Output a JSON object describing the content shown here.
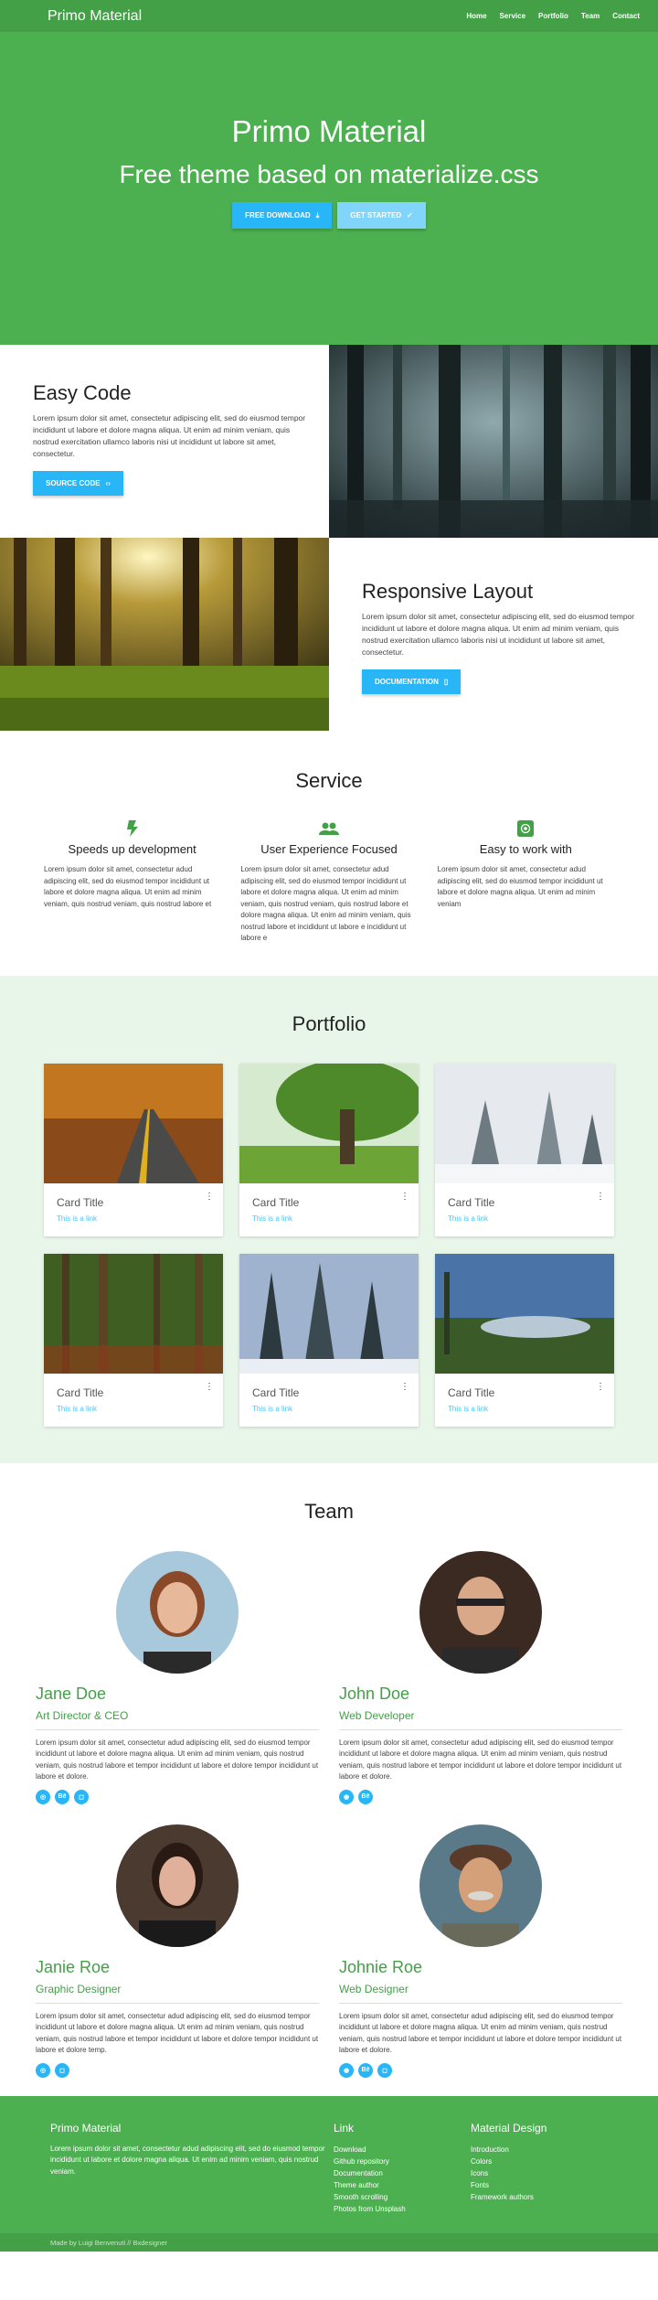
{
  "nav": {
    "brand": "Primo Material",
    "links": [
      "Home",
      "Service",
      "Portfolio",
      "Team",
      "Contact"
    ]
  },
  "hero": {
    "title": "Primo Material",
    "subtitle": "Free theme based on materialize.css",
    "btn1": "FREE DOWNLOAD",
    "btn2": "GET STARTED"
  },
  "easy": {
    "title": "Easy Code",
    "text": "Lorem ipsum dolor sit amet, consectetur adipiscing elit, sed do eiusmod tempor incididunt ut labore et dolore magna aliqua. Ut enim ad minim veniam, quis nostrud exercitation ullamco laboris nisi ut  incididunt ut labore sit amet, consectetur.",
    "btn": "SOURCE CODE"
  },
  "responsive": {
    "title": "Responsive Layout",
    "text": "Lorem ipsum dolor sit amet, consectetur adipiscing elit, sed do eiusmod tempor incididunt ut labore et dolore magna aliqua. Ut enim ad minim veniam, quis nostrud exercitation ullamco laboris nisi ut  incididunt ut labore sit amet, consectetur.",
    "btn": "DOCUMENTATION"
  },
  "service": {
    "title": "Service",
    "items": [
      {
        "title": "Speeds up development",
        "text": "Lorem ipsum dolor sit amet, consectetur  adud adipiscing elit, sed do eiusmod tempor incididunt ut labore et dolore magna aliqua. Ut enim ad minim veniam, quis nostrud veniam, quis nostrud labore et"
      },
      {
        "title": "User Experience Focused",
        "text": "Lorem ipsum dolor sit amet, consectetur  adud adipiscing elit, sed do eiusmod tempor incididunt ut labore et dolore magna aliqua. Ut enim ad minim veniam, quis nostrud veniam, quis nostrud labore et dolore magna aliqua. Ut enim ad minim veniam, quis nostrud labore et incididunt ut labore e incididunt ut labore e"
      },
      {
        "title": "Easy to work with",
        "text": "Lorem ipsum dolor sit amet, consectetur  adud adipiscing elit, sed do eiusmod tempor incididunt ut labore et dolore magna aliqua. Ut enim ad minim veniam"
      }
    ]
  },
  "portfolio": {
    "title": "Portfolio",
    "cards": [
      {
        "title": "Card Title",
        "link": "This is a link"
      },
      {
        "title": "Card Title",
        "link": "This is a link"
      },
      {
        "title": "Card Title",
        "link": "This is a link"
      },
      {
        "title": "Card Title",
        "link": "This is a link"
      },
      {
        "title": "Card Title",
        "link": "This is a link"
      },
      {
        "title": "Card Title",
        "link": "This is a link"
      }
    ]
  },
  "team": {
    "title": "Team",
    "members": [
      {
        "name": "Jane Doe",
        "role": "Art Director & CEO",
        "text": "Lorem ipsum dolor sit amet, consectetur  adud adipiscing elit, sed do eiusmod tempor incididunt ut labore et dolore magna aliqua. Ut enim ad minim veniam, quis nostrud veniam, quis nostrud labore et tempor incididunt ut labore et dolore tempor incididunt ut labore et dolore."
      },
      {
        "name": "John Doe",
        "role": "Web Developer",
        "text": "Lorem ipsum dolor sit amet, consectetur  adud adipiscing elit, sed do eiusmod tempor incididunt ut labore et dolore magna aliqua. Ut enim ad minim veniam, quis nostrud veniam, quis nostrud labore et tempor incididunt ut labore et dolore tempor incididunt ut labore et dolore."
      },
      {
        "name": "Janie Roe",
        "role": "Graphic Designer",
        "text": "Lorem ipsum dolor sit amet, consectetur  adud adipiscing elit, sed do eiusmod tempor incididunt ut labore et dolore magna aliqua. Ut enim ad minim veniam, quis nostrud veniam, quis nostrud labore et tempor incididunt ut labore et dolore tempor incididunt ut labore et dolore temp."
      },
      {
        "name": "Johnie Roe",
        "role": "Web Designer",
        "text": "Lorem ipsum dolor sit amet, consectetur  adud adipiscing elit, sed do eiusmod tempor incididunt ut labore et dolore magna aliqua. Ut enim ad minim veniam, quis nostrud veniam, quis nostrud labore et tempor incididunt ut labore et dolore tempor incididunt ut labore et dolore."
      }
    ]
  },
  "footer": {
    "about_title": "Primo Material",
    "about_text": "Lorem ipsum dolor sit amet, consectetur  adud adipiscing elit, sed do eiusmod tempor incididunt ut labore et dolore magna aliqua. Ut enim ad minim veniam, quis nostrud veniam.",
    "link_title": "Link",
    "links": [
      "Download",
      "Github repository",
      "Documentation",
      "Theme author",
      "Smooth scrolling",
      "Photos from Unsplash"
    ],
    "md_title": "Material Design",
    "md_links": [
      "Introduction",
      "Colors",
      "Icons",
      "Fonts",
      "Framework authors"
    ],
    "copyright": "Made by Luigi Benvenuti // Bxdesigner"
  },
  "colors": {
    "primary": "#4caf50",
    "dark": "#43a047",
    "accent": "#29b6f6",
    "light_bg": "#e8f5e9"
  }
}
